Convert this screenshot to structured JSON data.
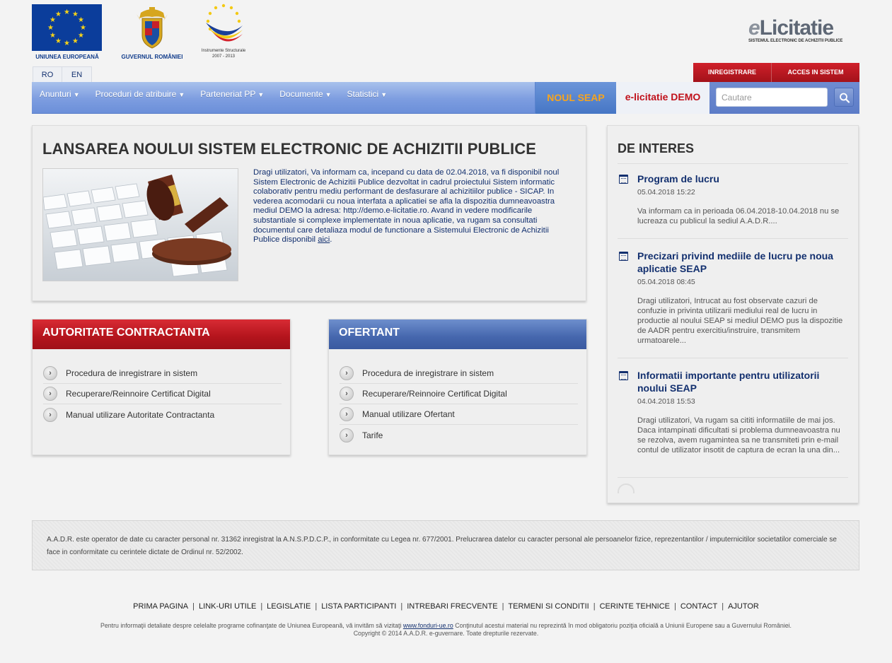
{
  "header": {
    "logos": {
      "eu_caption": "UNIUNEA EUROPEANĂ",
      "gov_caption": "GUVERNUL ROMÂNIEI",
      "is_caption_1": "Instrumente Structurale",
      "is_caption_2": "2007 - 2013"
    },
    "brand": {
      "e": "e",
      "title": "Licitatie",
      "subtitle": "SISTEMUL ELECTRONIC DE ACHIZITII PUBLICE"
    },
    "languages": [
      "RO",
      "EN"
    ],
    "auth": {
      "register": "INREGISTRARE",
      "login": "ACCES IN SISTEM"
    }
  },
  "nav": {
    "items": [
      "Anunturi",
      "Proceduri de atribuire",
      "Parteneriat PP",
      "Documente",
      "Statistici"
    ],
    "caret": "▼",
    "noul_seap": "NOUL SEAP",
    "demo": "e-licitatie DEMO",
    "search_placeholder": "Cautare"
  },
  "main": {
    "title": "LANSAREA NOULUI SISTEM ELECTRONIC DE ACHIZITII PUBLICE",
    "text": "Dragi utilizatori, Va informam ca, incepand cu data de 02.04.2018, va fi disponibil noul Sistem Electronic de Achizitii Publice dezvoltat in cadrul proiectului Sistem informatic colaborativ pentru mediu performant de desfasurare al achizitiilor publice - SICAP. In vederea acomodarii cu noua interfata a aplicatiei se afla la dispozitia dumneavoastra mediul DEMO la adresa: http://demo.e-licitatie.ro. Avand in vedere modificarile substantiale si complexe implementate in noua aplicatie, va rugam sa consultati documentul care detaliaza modul de functionare a Sistemului Electronic de Achizitii Publice disponibil ",
    "link": "aici",
    "text_end": "."
  },
  "autoritate": {
    "title": "AUTORITATE CONTRACTANTA",
    "items": [
      "Procedura de inregistrare in sistem",
      "Recuperare/Reinnoire Certificat Digital",
      "Manual utilizare Autoritate Contractanta"
    ]
  },
  "ofertant": {
    "title": "OFERTANT",
    "items": [
      "Procedura de inregistrare in sistem",
      "Recuperare/Reinnoire Certificat Digital",
      "Manual utilizare Ofertant",
      "Tarife"
    ]
  },
  "interes": {
    "title": "DE INTERES",
    "news": [
      {
        "title": "Program de lucru",
        "date": "05.04.2018 15:22",
        "text": "Va informam ca in perioada 06.04.2018-10.04.2018 nu se lucreaza cu publicul la sediul A.A.D.R...."
      },
      {
        "title": "Precizari privind mediile de lucru pe noua aplicatie SEAP",
        "date": "05.04.2018 08:45",
        "text": "Dragi utilizatori, Intrucat au fost observate cazuri de confuzie in privinta utilizarii mediului real de lucru in productie al noului SEAP si mediul DEMO pus la dispozitie de AADR pentru exercitiu/instruire, transmitem urmatoarele..."
      },
      {
        "title": "Informatii importante pentru utilizatorii noului SEAP",
        "date": "04.04.2018 15:53",
        "text": "Dragi utilizatori, Va rugam sa cititi informatiile de mai jos. Daca intampinati dificultati si problema dumneavoastra nu se rezolva, avem rugamintea sa ne transmiteti prin e-mail contul de utilizator insotit de captura de ecran la una din..."
      }
    ]
  },
  "notice": "A.A.D.R. este operator de date cu caracter personal nr. 31362 inregistrat la A.N.S.P.D.C.P., in conformitate cu Legea nr. 677/2001. Prelucrarea datelor cu caracter personal ale persoanelor fizice, reprezentantilor / imputernicitilor societatilor comerciale se face in conformitate cu cerintele dictate de Ordinul nr. 52/2002.",
  "footer": {
    "links": [
      "PRIMA PAGINA",
      "LINK-URI UTILE",
      "LEGISLATIE",
      "LISTA PARTICIPANTI",
      "INTREBARI FRECVENTE",
      "TERMENI SI CONDITII",
      "CERINTE TEHNICE",
      "CONTACT",
      "AJUTOR"
    ],
    "separator": "|",
    "note_before": "Pentru informaţii detaliate despre celelalte programe cofinanţate de Uniunea Europeană, vă invităm să vizitaţi ",
    "note_link": "www.fonduri-ue.ro",
    "note_after": " Conţinutul acestui material nu reprezintă în mod obligatoriu poziţia oficială a Uniunii Europene sau a Guvernului României.",
    "copyright": "Copyright © 2014 A.A.D.R. e-guvernare. Toate drepturile rezervate."
  },
  "colors": {
    "accent_red": "#c0111b",
    "accent_blue": "#13306f",
    "orange": "#f7a41e"
  }
}
